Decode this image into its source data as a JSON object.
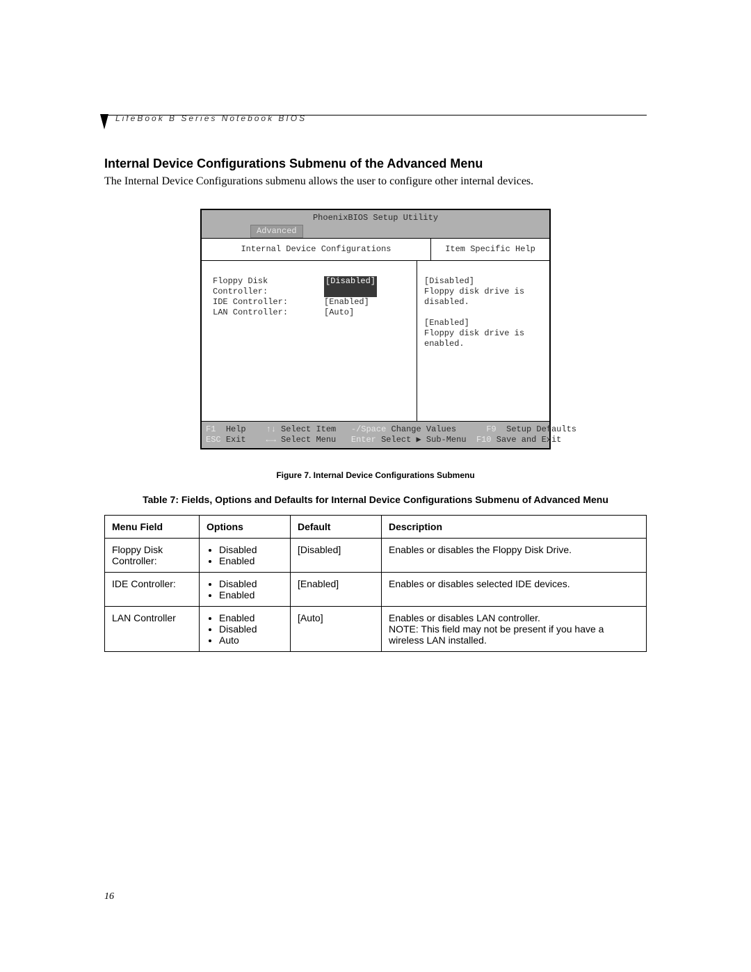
{
  "runhead": "LifeBook B Series Notebook BIOS",
  "section_title": "Internal Device Configurations Submenu of the Advanced Menu",
  "lead": "The Internal Device Configurations submenu allows the user to configure other internal devices.",
  "bios": {
    "title": "PhoenixBIOS Setup Utility",
    "tab": "Advanced",
    "left_head": "Internal Device Configurations",
    "right_head": "Item Specific Help",
    "items": [
      {
        "label": "Floppy Disk Controller:",
        "value": "[Disabled]",
        "selected": true
      },
      {
        "label": "IDE Controller:",
        "value": "[Enabled]",
        "selected": false
      },
      {
        "label": "LAN Controller:",
        "value": "[Auto]",
        "selected": false
      }
    ],
    "help": "[Disabled]\nFloppy disk drive is disabled.\n\n[Enabled]\nFloppy disk drive is enabled.",
    "footer": {
      "f1": "F1",
      "help": "Help",
      "updown": "↑↓",
      "select_item": "Select Item",
      "minus_space": "-/Space",
      "change_values": "Change Values",
      "f9": "F9",
      "setup_defaults": "Setup Defaults",
      "esc": "ESC",
      "exit": "Exit",
      "leftright": "←→",
      "select_menu": "Select Menu",
      "enter": "Enter",
      "sub_menu": "Select ▶ Sub-Menu",
      "f10": "F10",
      "save_exit": "Save and Exit"
    }
  },
  "figure_caption": "Figure 7.  Internal Device Configurations Submenu",
  "table_caption": "Table 7: Fields, Options and Defaults for Internal Device Configurations Submenu of Advanced Menu",
  "table": {
    "headers": [
      "Menu Field",
      "Options",
      "Default",
      "Description"
    ],
    "rows": [
      {
        "field": "Floppy Disk Controller:",
        "options": [
          "Disabled",
          "Enabled"
        ],
        "default": "[Disabled]",
        "description": "Enables or disables the Floppy Disk Drive."
      },
      {
        "field": "IDE Controller:",
        "options": [
          "Disabled",
          "Enabled"
        ],
        "default": "[Enabled]",
        "description": "Enables or disables selected IDE devices."
      },
      {
        "field": "LAN Controller",
        "options": [
          "Enabled",
          "Disabled",
          "Auto"
        ],
        "default": "[Auto]",
        "description": "Enables or disables LAN controller.\nNOTE: This field may not be present if you have a wireless LAN installed."
      }
    ]
  },
  "page_number": "16"
}
